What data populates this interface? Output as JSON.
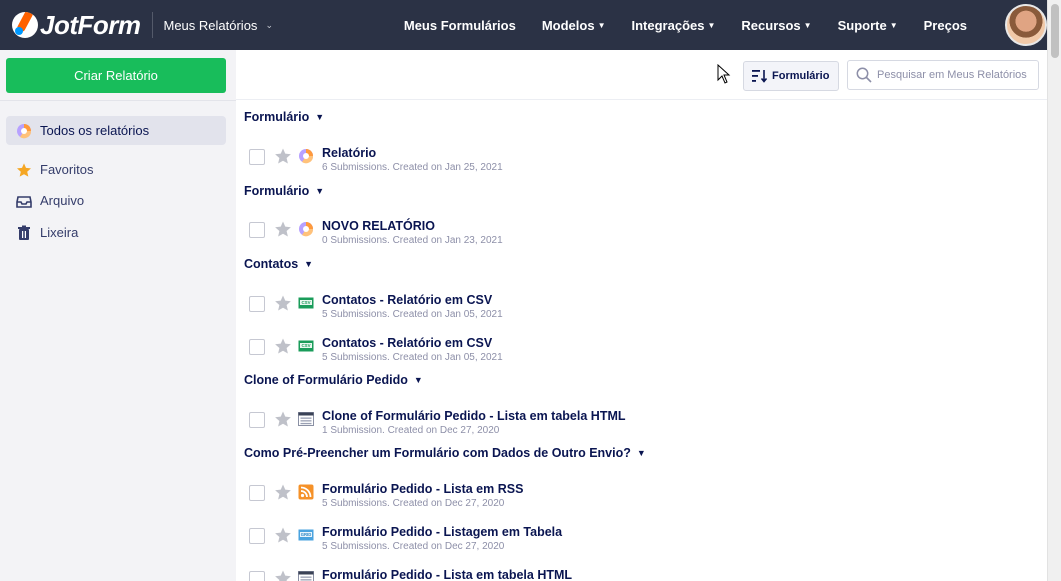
{
  "brand": {
    "name": "JotForm"
  },
  "app_switcher": {
    "label": "Meus Relatórios"
  },
  "nav": [
    {
      "label": "Meus Formulários",
      "caret": false
    },
    {
      "label": "Modelos",
      "caret": true
    },
    {
      "label": "Integrações",
      "caret": true
    },
    {
      "label": "Recursos",
      "caret": true
    },
    {
      "label": "Suporte",
      "caret": true
    },
    {
      "label": "Preços",
      "caret": false
    }
  ],
  "sidebar": {
    "create_label": "Criar Relatório",
    "items": [
      {
        "label": "Todos os relatórios",
        "icon": "report-pie-icon",
        "active": true
      },
      {
        "label": "Favoritos",
        "icon": "star-icon",
        "active": false
      },
      {
        "label": "Arquivo",
        "icon": "inbox-icon",
        "active": false
      },
      {
        "label": "Lixeira",
        "icon": "trash-icon",
        "active": false
      }
    ]
  },
  "toolbar": {
    "sort_label": "Formulário",
    "search_placeholder": "Pesquisar em Meus Relatórios"
  },
  "groups": [
    {
      "name": "Formulário",
      "reports": [
        {
          "title": "Relatório",
          "meta": "6 Submissions. Created on Jan 25, 2021",
          "icon": "pie-chart-icon"
        }
      ]
    },
    {
      "name": "Formulário",
      "reports": [
        {
          "title": "NOVO RELATÓRIO",
          "meta": "0 Submissions. Created on Jan 23, 2021",
          "icon": "pie-chart-icon"
        }
      ]
    },
    {
      "name": "Contatos",
      "reports": [
        {
          "title": "Contatos - Relatório em CSV",
          "meta": "5 Submissions. Created on Jan 05, 2021",
          "icon": "csv-icon"
        },
        {
          "title": "Contatos - Relatório em CSV",
          "meta": "5 Submissions. Created on Jan 05, 2021",
          "icon": "csv-icon"
        }
      ]
    },
    {
      "name": "Clone of Formulário Pedido",
      "reports": [
        {
          "title": "Clone of Formulário Pedido - Lista em tabela HTML",
          "meta": "1 Submission. Created on Dec 27, 2020",
          "icon": "html-table-icon"
        }
      ]
    },
    {
      "name": "Como Pré-Preencher um Formulário com Dados de Outro Envio?",
      "reports": [
        {
          "title": "Formulário Pedido - Lista em RSS",
          "meta": "5 Submissions. Created on Dec 27, 2020",
          "icon": "rss-icon"
        },
        {
          "title": "Formulário Pedido - Listagem em Tabela",
          "meta": "5 Submissions. Created on Dec 27, 2020",
          "icon": "grid-icon"
        },
        {
          "title": "Formulário Pedido - Lista em tabela HTML",
          "meta": "",
          "icon": "html-table-icon"
        }
      ]
    }
  ],
  "colors": {
    "topbar": "#2b3245",
    "create_button": "#18bd5b",
    "star": "#bfc1c9",
    "favorite_star": "#f5a623"
  }
}
